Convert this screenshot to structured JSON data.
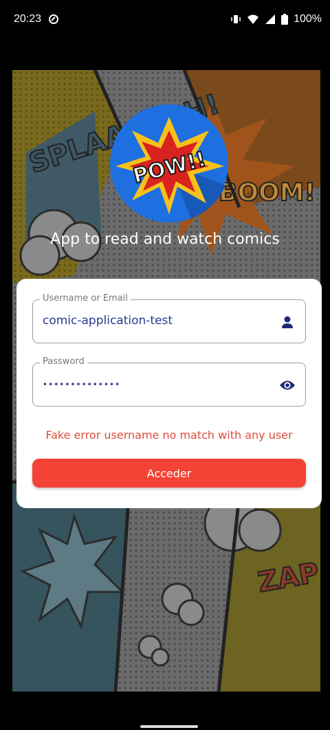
{
  "status_bar": {
    "time": "20:23",
    "battery": "100%"
  },
  "app": {
    "tagline": "App to read and watch comics",
    "logo_text": "POW!!"
  },
  "background_words": {
    "w1": "SPLAAAASH!",
    "w2": "BOOM!",
    "w3": "ZAP"
  },
  "login": {
    "username_label": "Username or Email",
    "username_value": "comic-application-test",
    "password_label": "Password",
    "password_value": "••••••••••••••",
    "error_text": "Fake error username no match with any user",
    "submit_label": "Acceder"
  },
  "colors": {
    "accent": "#f44336",
    "input_text": "#2a3791",
    "error": "#e04b3a"
  }
}
